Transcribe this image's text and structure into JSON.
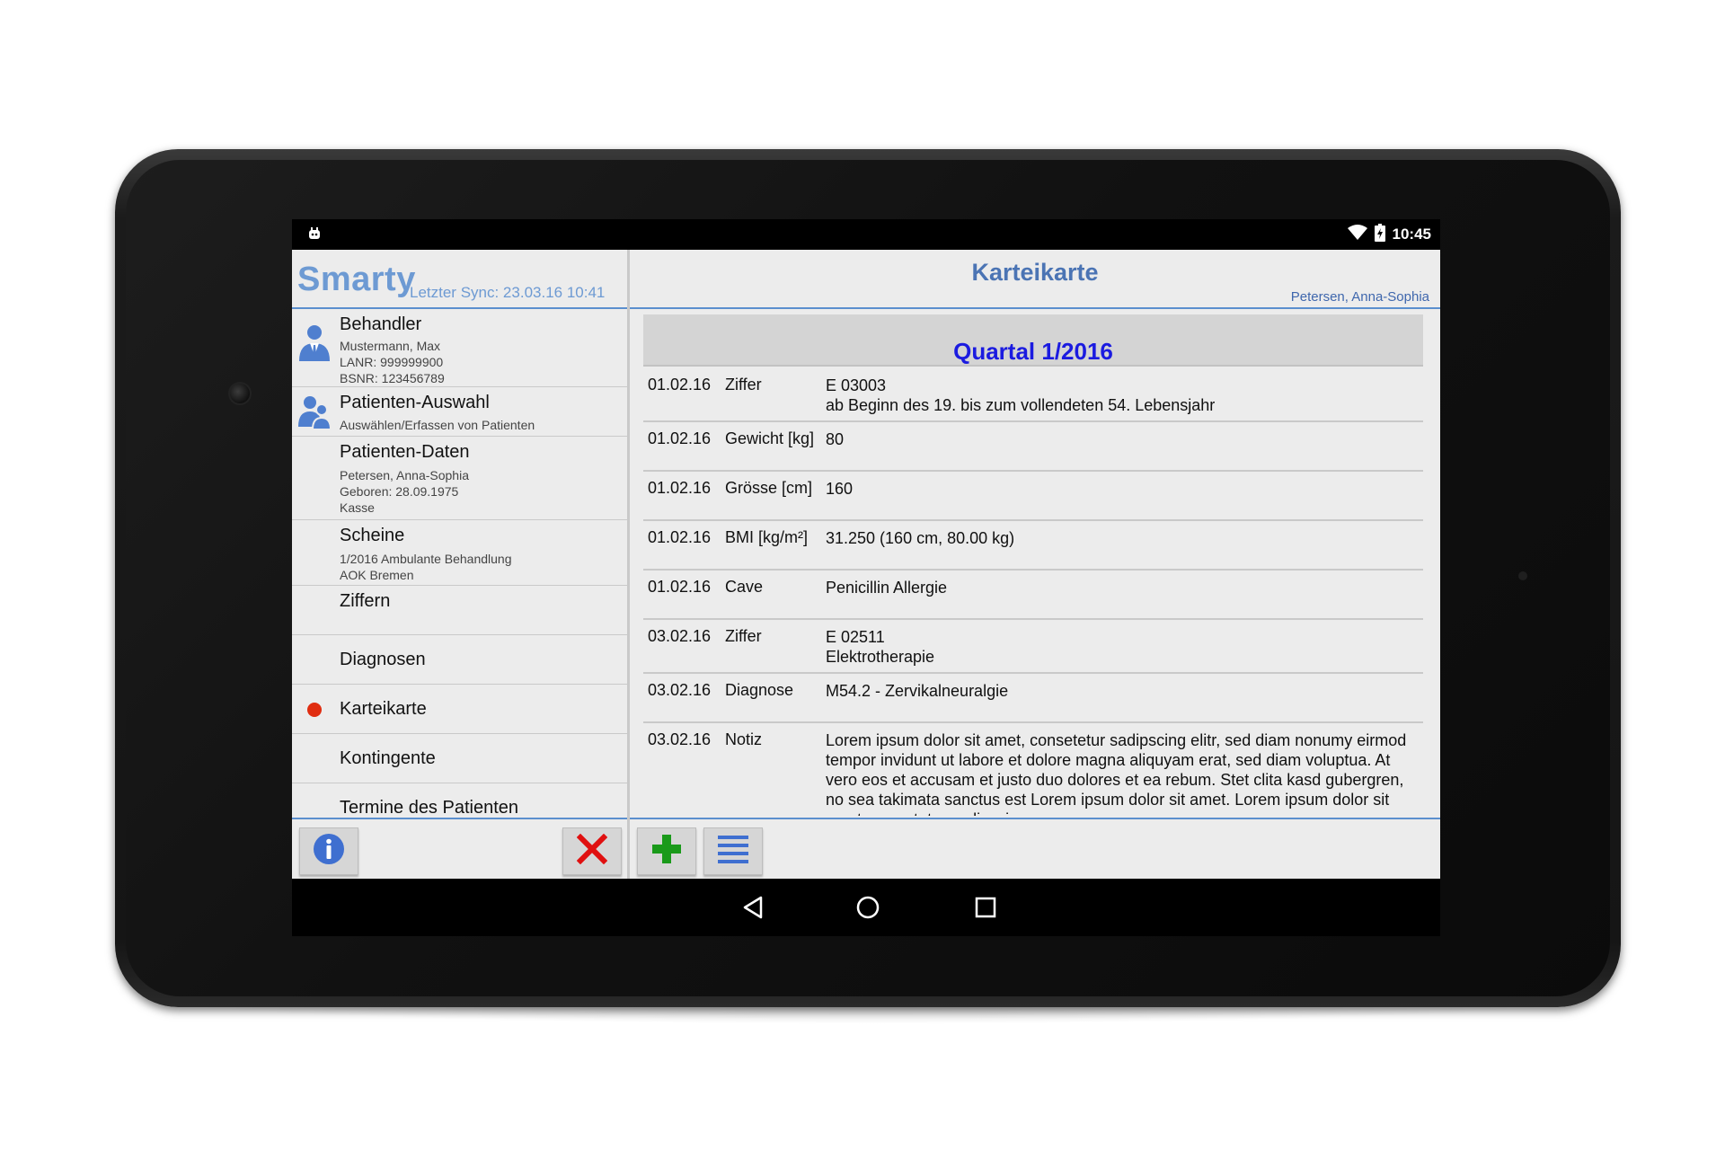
{
  "status": {
    "time": "10:45"
  },
  "app": {
    "name": "Smarty",
    "sync": "Letzter Sync: 23.03.16 10:41"
  },
  "nav": {
    "behandler": {
      "title": "Behandler",
      "line1": "Mustermann, Max",
      "line2": "LANR: 999999900",
      "line3": "BSNR: 123456789"
    },
    "auswahl": {
      "title": "Patienten-Auswahl",
      "line1": "Auswählen/Erfassen von Patienten"
    },
    "daten": {
      "title": "Patienten-Daten",
      "line1": "Petersen, Anna-Sophia",
      "line2": "Geboren: 28.09.1975",
      "line3": "Kasse"
    },
    "scheine": {
      "title": "Scheine",
      "line1": "1/2016 Ambulante Behandlung",
      "line2": "AOK Bremen"
    },
    "ziffern": {
      "title": "Ziffern"
    },
    "diagnosen": {
      "title": "Diagnosen"
    },
    "karteikarte": {
      "title": "Karteikarte"
    },
    "kontingente": {
      "title": "Kontingente"
    },
    "termine": {
      "title": "Termine des Patienten"
    }
  },
  "main": {
    "title": "Karteikarte",
    "patient": "Petersen, Anna-Sophia",
    "quarter": "Quartal 1/2016",
    "entries": [
      {
        "date": "01.02.16",
        "type": "Ziffer",
        "value": "E 03003",
        "value2": "ab Beginn des 19. bis zum vollendeten 54. Lebensjahr"
      },
      {
        "date": "01.02.16",
        "type": "Gewicht [kg]",
        "value": "80"
      },
      {
        "date": "01.02.16",
        "type": "Grösse [cm]",
        "value": "160"
      },
      {
        "date": "01.02.16",
        "type": "BMI [kg/m²]",
        "value": "31.250 (160 cm, 80.00 kg)"
      },
      {
        "date": "01.02.16",
        "type": "Cave",
        "value": "Penicillin Allergie"
      },
      {
        "date": "03.02.16",
        "type": "Ziffer",
        "value": "E 02511",
        "value2": "Elektrotherapie"
      },
      {
        "date": "03.02.16",
        "type": "Diagnose",
        "value": "M54.2 - Zervikalneuralgie"
      },
      {
        "date": "03.02.16",
        "type": "Notiz",
        "value": "Lorem ipsum dolor sit amet, consetetur sadipscing elitr, sed diam nonumy eirmod tempor invidunt ut labore et dolore magna aliquyam erat, sed diam voluptua. At vero eos et accusam et justo duo dolores et ea rebum. Stet clita kasd gubergren, no sea takimata sanctus est Lorem ipsum dolor sit amet. Lorem ipsum dolor sit amet, consetetur sadipscing"
      }
    ]
  },
  "colors": {
    "accent": "#5b8fce",
    "title_blue": "#4b74b4",
    "quarter_blue": "#1b1be0",
    "active_dot": "#e02d10",
    "add_green": "#1a9a1a",
    "close_red": "#e01010"
  }
}
